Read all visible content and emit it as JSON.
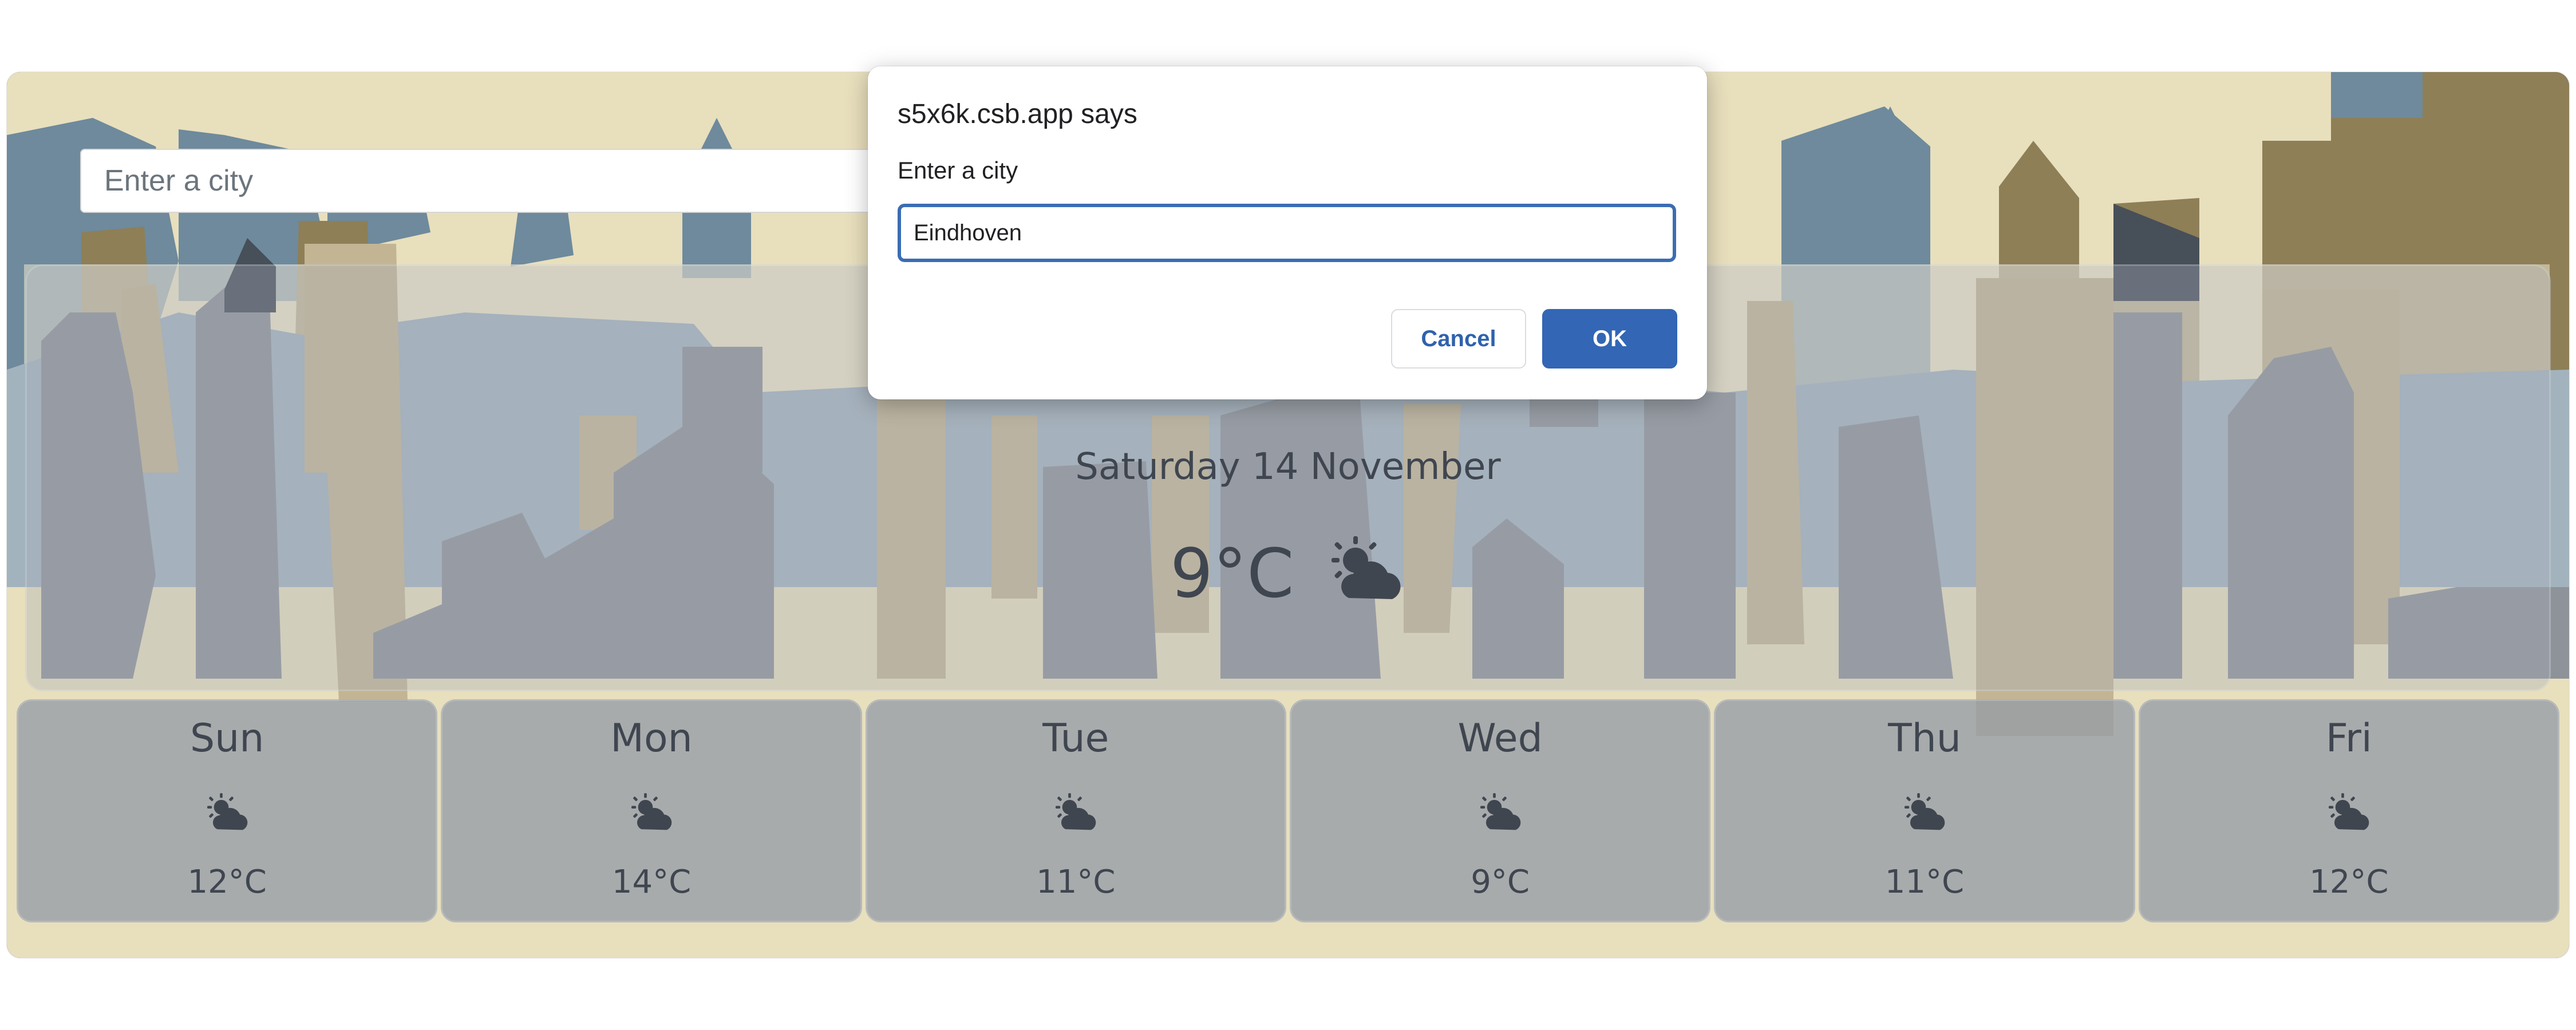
{
  "search": {
    "placeholder": "Enter a city"
  },
  "current": {
    "date": "Saturday 14 November",
    "temperature": "9°C",
    "icon": "sun-behind-cloud-icon"
  },
  "forecast": [
    {
      "day": "Sun",
      "temp": "12°C",
      "icon": "sun-behind-cloud-icon"
    },
    {
      "day": "Mon",
      "temp": "14°C",
      "icon": "sun-behind-cloud-icon"
    },
    {
      "day": "Tue",
      "temp": "11°C",
      "icon": "sun-behind-cloud-icon"
    },
    {
      "day": "Wed",
      "temp": "9°C",
      "icon": "sun-behind-cloud-icon"
    },
    {
      "day": "Thu",
      "temp": "11°C",
      "icon": "sun-behind-cloud-icon"
    },
    {
      "day": "Fri",
      "temp": "12°C",
      "icon": "sun-behind-cloud-icon"
    }
  ],
  "dialog": {
    "title": "s5x6k.csb.app says",
    "message": "Enter a city",
    "input_value": "Eindhoven",
    "cancel_label": "Cancel",
    "ok_label": "OK"
  },
  "colors": {
    "sky": "#e8dfbd",
    "building_dark": "#474f59",
    "building_slate": "#6e8a9c",
    "building_tan": "#8e7f57",
    "accent": "#3366b5"
  }
}
